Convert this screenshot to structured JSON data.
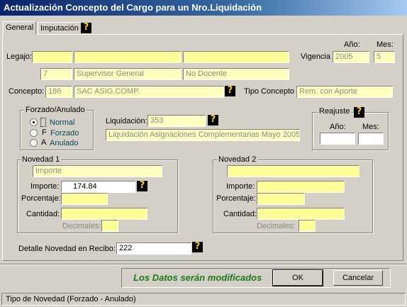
{
  "window": {
    "title": "Actualización Concepto del Cargo para un Nro.Liquidación"
  },
  "tabs": [
    {
      "label": "General"
    },
    {
      "label": "Imputación"
    }
  ],
  "legajo": {
    "label": "Legajo:",
    "field1": "",
    "field2": "",
    "field3": ""
  },
  "vigencia": {
    "label": "Vigencia",
    "anio_label": "Año:",
    "mes_label": "Mes:",
    "anio": "2005",
    "mes": "5"
  },
  "cargo": {
    "codigo": "7",
    "descripcion": "Supervisor General",
    "tipo": "No Docente"
  },
  "concepto": {
    "label": "Concepto:",
    "codigo": "186",
    "descripcion": "SAC ASIG.COMP.",
    "tipo_label": "Tipo Concepto",
    "tipo": "Rem. con Aporte"
  },
  "forzado": {
    "title": "Forzado/Anulado",
    "options": [
      {
        "key": "",
        "label": "Normal"
      },
      {
        "key": "F",
        "label": "Forzado"
      },
      {
        "key": "A",
        "label": "Anulado"
      }
    ]
  },
  "liquidacion": {
    "label": "Liquidación:",
    "numero": "353",
    "descripcion": "Liquidación Asignaciones Complementarias Mayo 2005"
  },
  "reajuste": {
    "title": "Reajuste",
    "anio_label": "Año:",
    "mes_label": "Mes:",
    "anio": "",
    "mes": ""
  },
  "novedad1": {
    "title": "Novedad 1",
    "tipo": "Importe",
    "importe_label": "Importe:",
    "importe": "174.84",
    "porcentaje_label": "Porcentaje:",
    "porcentaje": "",
    "cantidad_label": "Cantidad:",
    "cantidad": "",
    "decimales_label": "Decimales:",
    "decimales": ""
  },
  "novedad2": {
    "title": "Novedad 2",
    "tipo": "",
    "importe_label": "Importe:",
    "importe": "",
    "porcentaje_label": "Porcentaje:",
    "porcentaje": "",
    "cantidad_label": "Cantidad:",
    "cantidad": "",
    "decimales_label": "Decimales:",
    "decimales": ""
  },
  "detalle": {
    "label": "Detalle Novedad en Recibo:",
    "value": "222"
  },
  "footer": {
    "message": "Los Datos serán modificados",
    "ok_label": "OK",
    "cancel_label": "Cancelar"
  },
  "status": {
    "text": "Tipo de Novedad (Forzado - Anulado)"
  }
}
